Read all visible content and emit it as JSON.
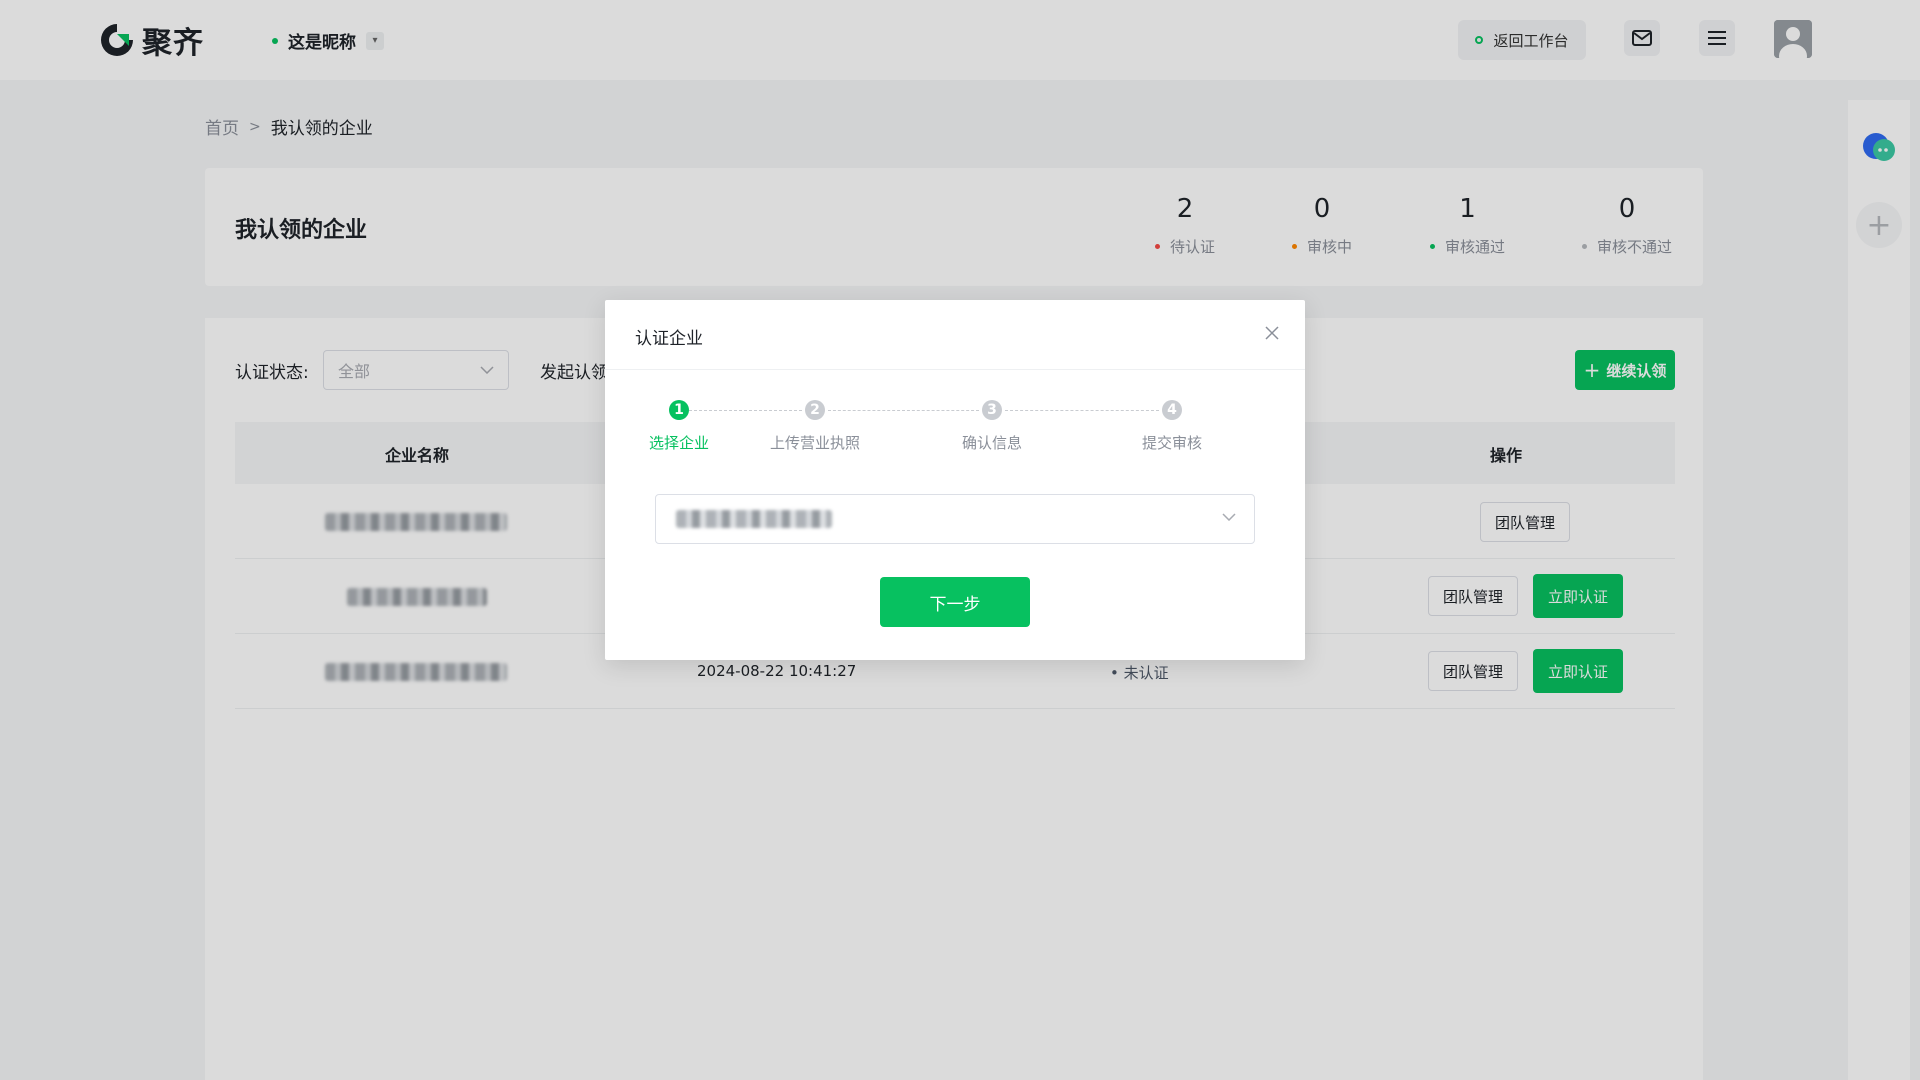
{
  "header": {
    "logo_text": "聚齐",
    "nickname": "这是昵称",
    "back_label": "返回工作台"
  },
  "breadcrumb": {
    "home": "首页",
    "separator": ">",
    "current": "我认领的企业"
  },
  "stats": {
    "title": "我认领的企业",
    "items": [
      {
        "value": "2",
        "label": "待认证",
        "color": "#f54a45"
      },
      {
        "value": "0",
        "label": "审核中",
        "color": "#ff8800"
      },
      {
        "value": "1",
        "label": "审核通过",
        "color": "#07c160"
      },
      {
        "value": "0",
        "label": "审核不通过",
        "color": "#b5b8bd"
      }
    ]
  },
  "filters": {
    "status_label": "认证状态:",
    "status_value": "全部",
    "initiator_label": "发起认领",
    "continue_label": "继续认领"
  },
  "table": {
    "columns": {
      "name": "企业名称",
      "actions": "操作"
    },
    "rows": [
      {
        "time": "",
        "status": "",
        "team_label": "团队管理",
        "verify_label": ""
      },
      {
        "time": "",
        "status": "",
        "team_label": "团队管理",
        "verify_label": "立即认证"
      },
      {
        "time": "2024-08-22 10:41:27",
        "status": "• 未认证",
        "team_label": "团队管理",
        "verify_label": "立即认证"
      }
    ]
  },
  "modal": {
    "title": "认证企业",
    "steps": [
      {
        "num": "1",
        "label": "选择企业"
      },
      {
        "num": "2",
        "label": "上传营业执照"
      },
      {
        "num": "3",
        "label": "确认信息"
      },
      {
        "num": "4",
        "label": "提交审核"
      }
    ],
    "active_step": 1,
    "next_label": "下一步"
  },
  "colors": {
    "accent": "#07c160",
    "step_inactive": "#c9ccd1"
  }
}
